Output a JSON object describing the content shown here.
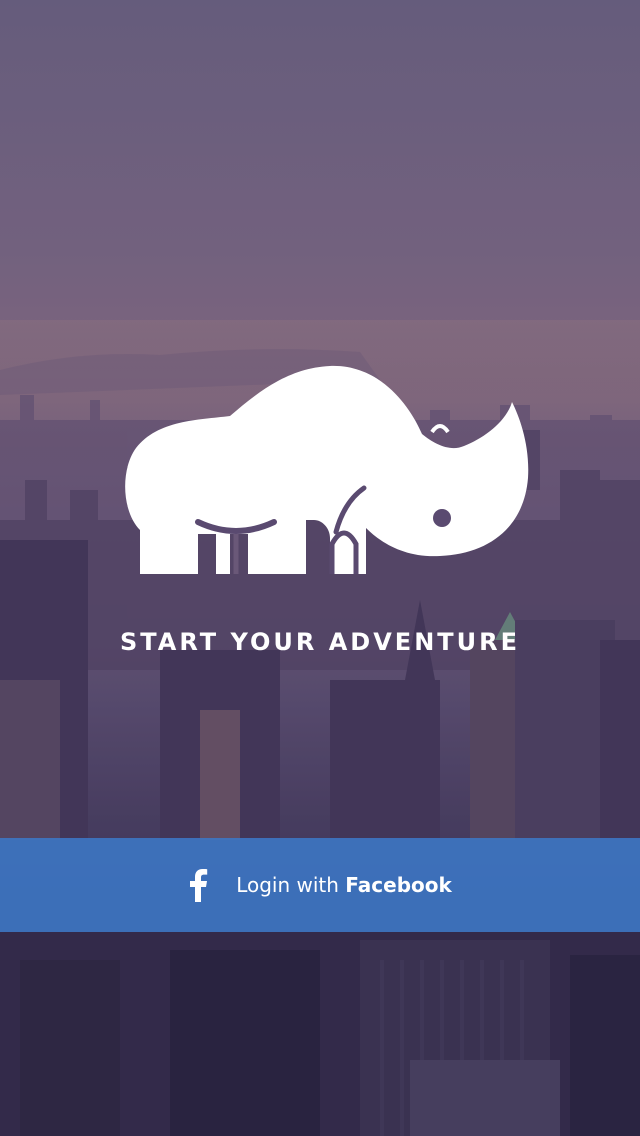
{
  "splash": {
    "tagline": "START YOUR ADVENTURE",
    "logo_icon": "rhino-icon",
    "background": "city-skyline-photo"
  },
  "login": {
    "prefix": "Login with ",
    "provider": "Facebook",
    "icon": "facebook-icon",
    "bar_color": "#3c78c6"
  }
}
